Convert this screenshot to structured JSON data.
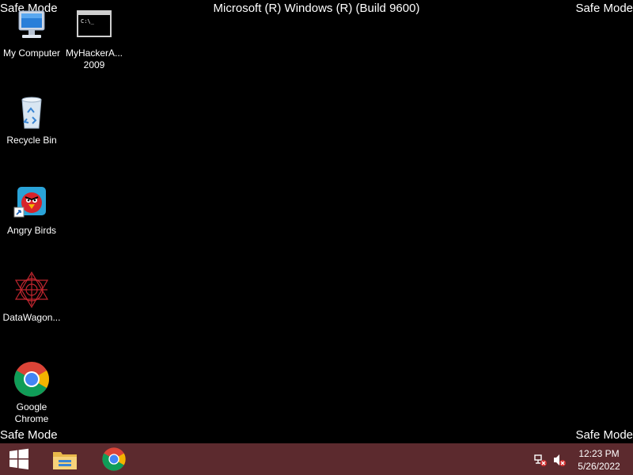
{
  "header": {
    "safe_mode_label": "Safe Mode",
    "os_title": "Microsoft (R) Windows (R) (Build 9600)"
  },
  "desktop": {
    "icons": [
      {
        "label": "My Computer",
        "icon": "computer-icon"
      },
      {
        "label": "MyHackerA... 2009",
        "label_line1": "MyHackerA...",
        "label_line2": "2009",
        "icon": "command-prompt-icon"
      },
      {
        "label": "Recycle Bin",
        "icon": "recycle-bin-icon"
      },
      {
        "label": "Angry Birds",
        "icon": "angry-birds-icon"
      },
      {
        "label": "DataWagon...",
        "icon": "datawagon-icon"
      },
      {
        "label_line1": "Google",
        "label_line2": "Chrome",
        "icon": "chrome-icon"
      }
    ]
  },
  "taskbar": {
    "background": "#5c2a2e",
    "start_icon": "windows-logo-icon",
    "pinned": [
      "file-explorer-icon",
      "chrome-icon"
    ],
    "tray": [
      "network-error-icon",
      "speaker-muted-icon"
    ],
    "clock": {
      "time": "12:23 PM",
      "date": "5/26/2022"
    }
  }
}
